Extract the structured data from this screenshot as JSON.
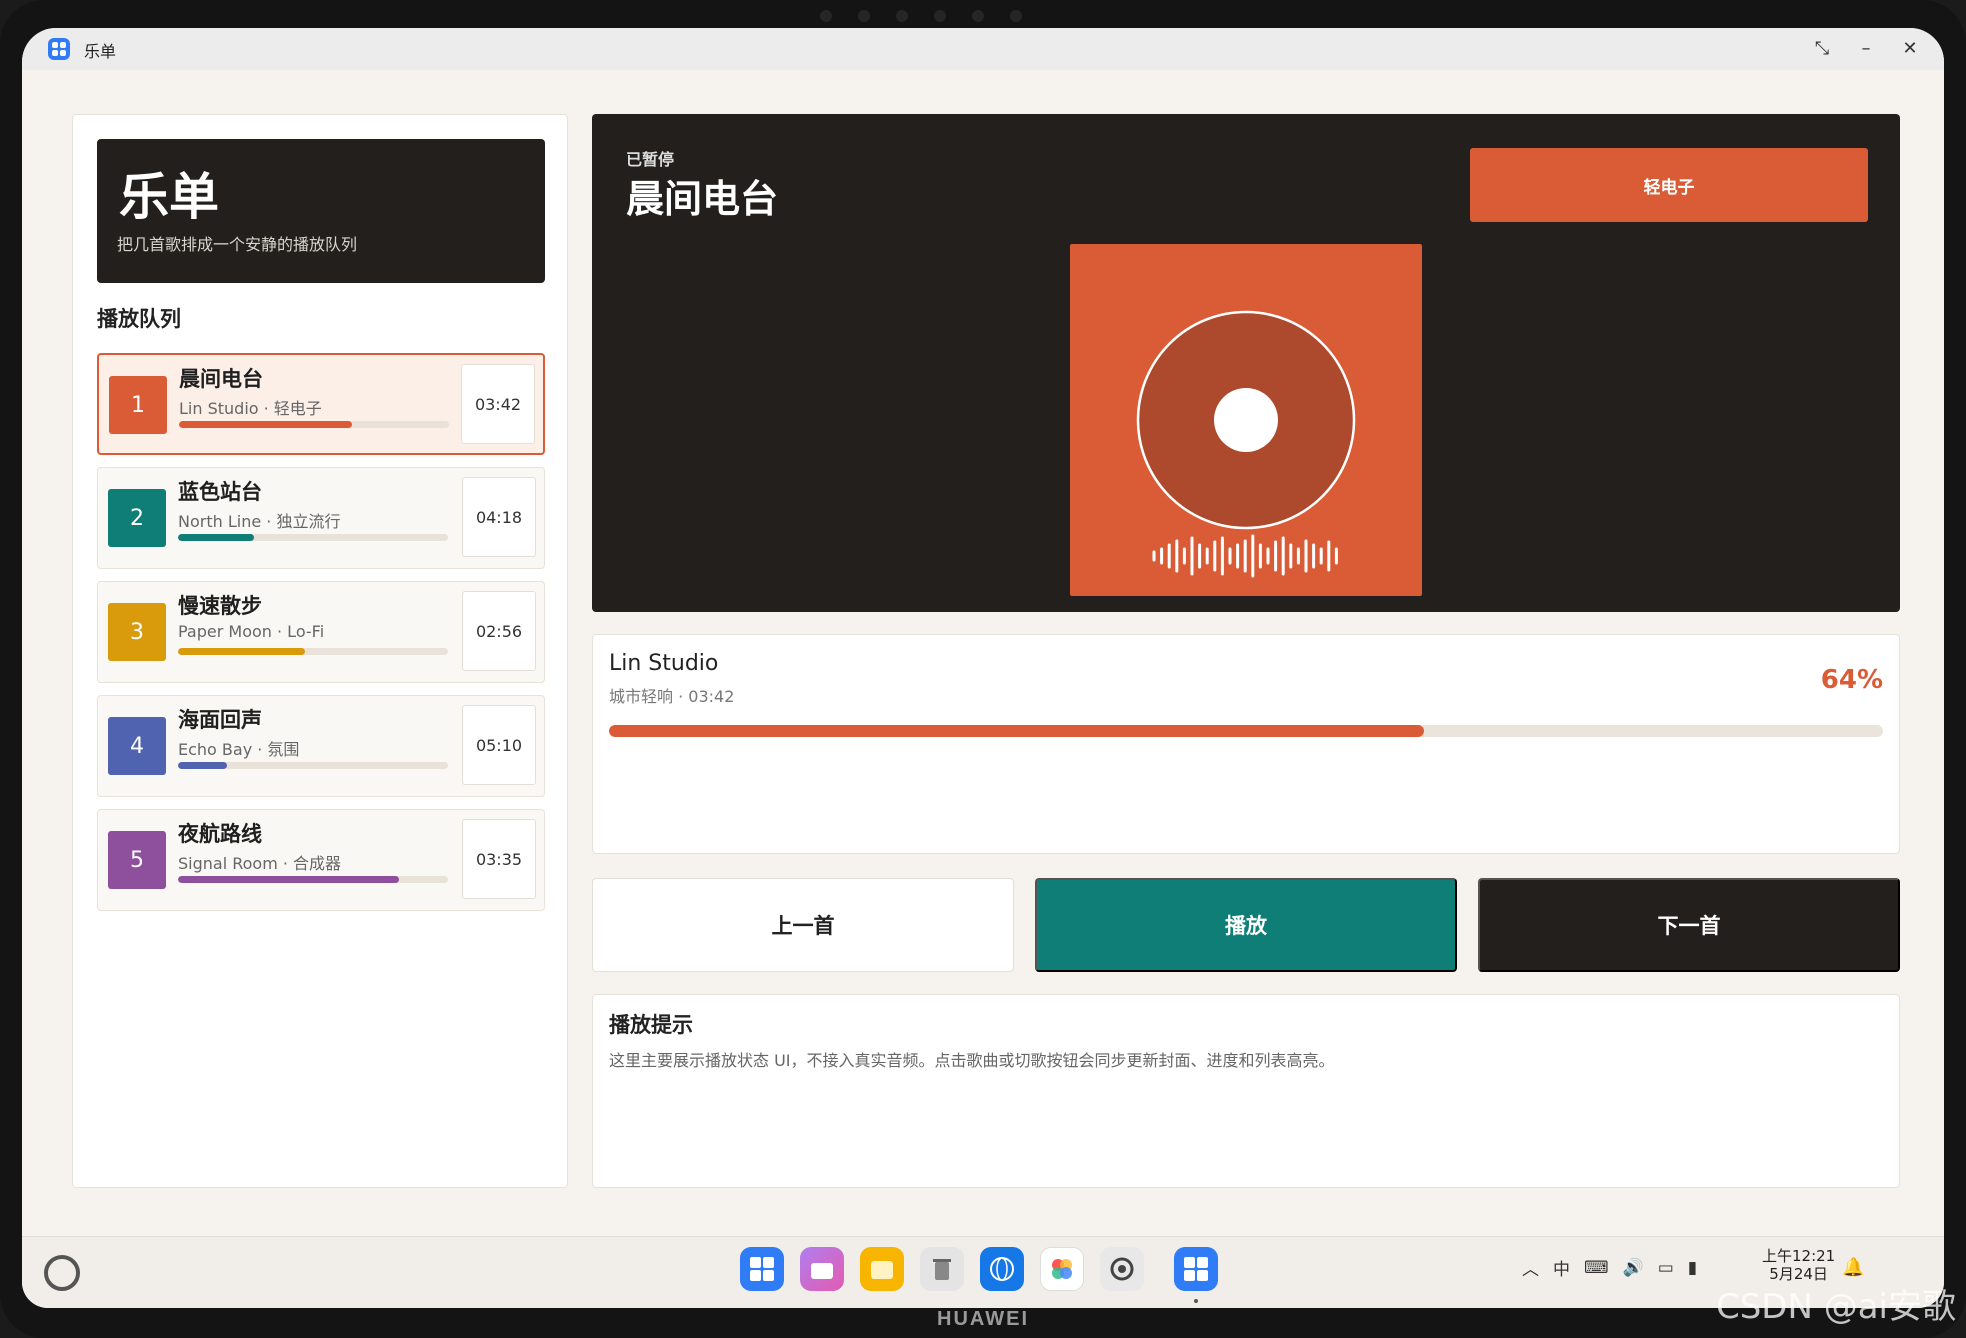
{
  "window": {
    "title": "乐单"
  },
  "hero": {
    "title": "乐单",
    "subtitle": "把几首歌排成一个安静的播放队列"
  },
  "queue": {
    "heading": "播放队列",
    "items": [
      {
        "num": "1",
        "title": "晨间电台",
        "meta": "Lin Studio · 轻电子",
        "duration": "03:42",
        "color": "#d95c37",
        "progress": 0.64,
        "active": true
      },
      {
        "num": "2",
        "title": "蓝色站台",
        "meta": "North Line · 独立流行",
        "duration": "04:18",
        "color": "#0f7e77",
        "progress": 0.28,
        "active": false
      },
      {
        "num": "3",
        "title": "慢速散步",
        "meta": "Paper Moon · Lo-Fi",
        "duration": "02:56",
        "color": "#d99a0b",
        "progress": 0.47,
        "active": false
      },
      {
        "num": "4",
        "title": "海面回声",
        "meta": "Echo Bay · 氛围",
        "duration": "05:10",
        "color": "#4f63b0",
        "progress": 0.18,
        "active": false
      },
      {
        "num": "5",
        "title": "夜航路线",
        "meta": "Signal Room · 合成器",
        "duration": "03:35",
        "color": "#8e4f9c",
        "progress": 0.82,
        "active": false
      }
    ]
  },
  "now_playing": {
    "status": "已暂停",
    "title": "晨间电台",
    "tag": "轻电子",
    "accent": "#d95c37"
  },
  "progress": {
    "artist": "Lin Studio",
    "meta": "城市轻响 · 03:42",
    "percent_label": "64%",
    "value": 0.64
  },
  "controls": {
    "prev": "上一首",
    "play": "播放",
    "next": "下一首"
  },
  "tip": {
    "title": "播放提示",
    "text": "这里主要展示播放状态 UI，不接入真实音频。点击歌曲或切歌按钮会同步更新封面、进度和列表高亮。"
  },
  "taskbar": {
    "clock_time": "上午12:21",
    "clock_date": "5月24日",
    "ime": "中"
  },
  "brand": "HUAWEI",
  "watermark": "CSDN @ai安歌"
}
